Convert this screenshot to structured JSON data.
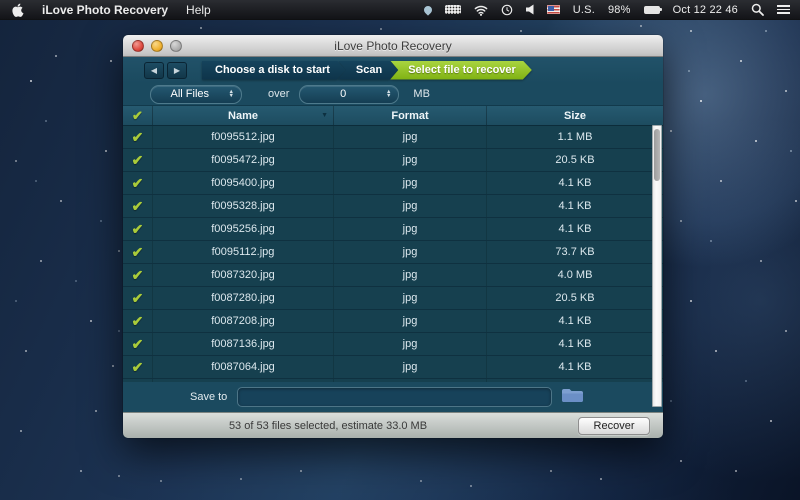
{
  "icons": {
    "check": "✔",
    "sort": "▼",
    "back": "◀",
    "forward": "▶",
    "spin_up": "▲",
    "spin_down": "▼"
  },
  "menu_bar": {
    "app_name": "iLove Photo Recovery",
    "menus": [
      "Help"
    ],
    "status": {
      "input_label": "U.S.",
      "battery": "98%",
      "clock": "Oct 12 22 46"
    }
  },
  "window": {
    "title": "iLove Photo Recovery",
    "toolbar": {
      "steps": [
        {
          "label": "Choose a disk to start"
        },
        {
          "label": "Scan"
        },
        {
          "label": "Select file to recover"
        }
      ],
      "active_step": "Select file to recover",
      "active_color": "#8fbd1f"
    },
    "filter": {
      "file_type": "All Files",
      "over_label": "over",
      "size_value": "0",
      "unit_label": "MB"
    },
    "table": {
      "columns": [
        "Name",
        "Format",
        "Size"
      ],
      "rows": [
        {
          "name": "f0095512.jpg",
          "format": "jpg",
          "size": "1.1 MB"
        },
        {
          "name": "f0095472.jpg",
          "format": "jpg",
          "size": "20.5 KB"
        },
        {
          "name": "f0095400.jpg",
          "format": "jpg",
          "size": "4.1 KB"
        },
        {
          "name": "f0095328.jpg",
          "format": "jpg",
          "size": "4.1 KB"
        },
        {
          "name": "f0095256.jpg",
          "format": "jpg",
          "size": "4.1 KB"
        },
        {
          "name": "f0095112.jpg",
          "format": "jpg",
          "size": "73.7 KB"
        },
        {
          "name": "f0087320.jpg",
          "format": "jpg",
          "size": "4.0 MB"
        },
        {
          "name": "f0087280.jpg",
          "format": "jpg",
          "size": "20.5 KB"
        },
        {
          "name": "f0087208.jpg",
          "format": "jpg",
          "size": "4.1 KB"
        },
        {
          "name": "f0087136.jpg",
          "format": "jpg",
          "size": "4.1 KB"
        },
        {
          "name": "f0087064.jpg",
          "format": "jpg",
          "size": "4.1 KB"
        },
        {
          "name": "",
          "format": "",
          "size": ""
        }
      ]
    },
    "save_to": {
      "label": "Save to",
      "path": ""
    },
    "status_bar": {
      "summary": "53 of 53 files selected, estimate 33.0 MB",
      "recover_label": "Recover"
    }
  }
}
